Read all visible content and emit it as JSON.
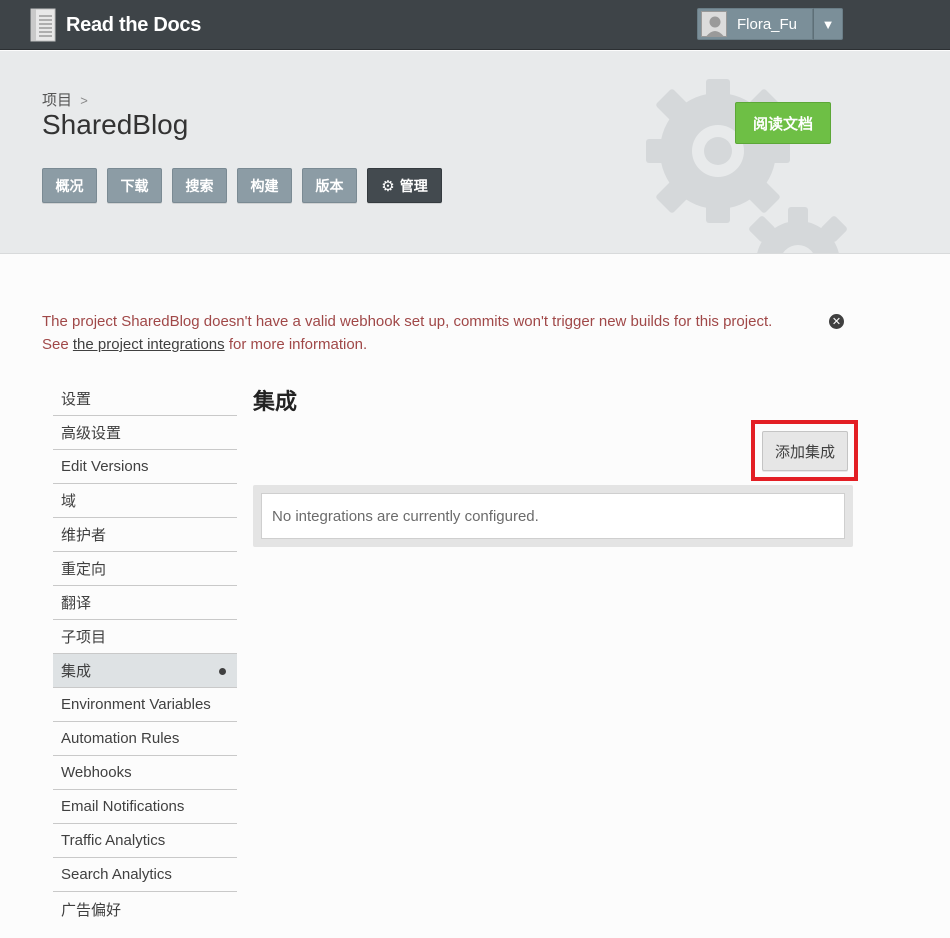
{
  "topbar": {
    "brand": "Read the Docs",
    "user_name": "Flora_Fu",
    "caret_glyph": "▼"
  },
  "header": {
    "breadcrumb": "项目",
    "breadcrumb_sep": ">",
    "project_name": "SharedBlog",
    "read_docs_label": "阅读文档",
    "tabs": [
      "概况",
      "下载",
      "搜索",
      "构建",
      "版本",
      "管理"
    ]
  },
  "alert": {
    "line1": "The project SharedBlog doesn't have a valid webhook set up, commits won't trigger new builds for this project.",
    "see": "See",
    "link_text": "the project integrations",
    "rest": "for more information.",
    "close_glyph": "✕"
  },
  "sidebar": {
    "items": [
      "设置",
      "高级设置",
      "Edit Versions",
      "域",
      "维护者",
      "重定向",
      "翻译",
      "子项目",
      "集成",
      "Environment Variables",
      "Automation Rules",
      "Webhooks",
      "Email Notifications",
      "Traffic Analytics",
      "Search Analytics",
      "广告偏好"
    ],
    "active_index": 8
  },
  "main": {
    "title": "集成",
    "add_button": "添加集成",
    "empty_text": "No integrations are currently configured."
  },
  "colors": {
    "topbar": "#3e4448",
    "read_docs": "#6ebf45",
    "tab": "#8c9ca5",
    "tab_active": "#434a4f",
    "alert_text": "#a04848",
    "highlight": "#e31e24"
  },
  "icons": {
    "logo": "book-icon",
    "avatar": "user-avatar-icon",
    "tab_manage": "gear-icon",
    "alert_close": "close-circle-icon",
    "active_indicator": "dot-icon"
  }
}
